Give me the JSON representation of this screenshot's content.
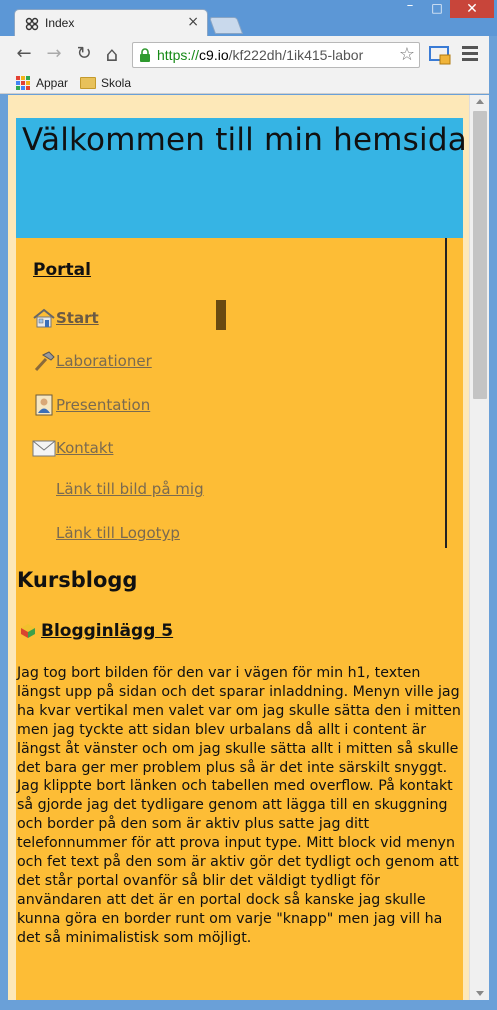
{
  "browser": {
    "tab_title": "Index",
    "tab_close": "×",
    "window_min": "–",
    "window_max": "□",
    "window_close": "✕",
    "nav": {
      "back": "←",
      "forward": "→",
      "reload": "↻",
      "home": "⌂"
    },
    "url": {
      "scheme": "https://",
      "host": "c9.io",
      "path": "/kf222dh/1ik415-labor"
    },
    "star": "☆",
    "bookmarks": [
      {
        "label": "Appar",
        "icon": "apps-grid-icon"
      },
      {
        "label": "Skola",
        "icon": "folder-icon"
      }
    ]
  },
  "page": {
    "header_title": "Välkommen till min hemsida",
    "nav_heading": "Portal",
    "nav_items": [
      {
        "label": "Start",
        "icon": "house-icon",
        "active": true
      },
      {
        "label": "Laborationer",
        "icon": "hammer-icon"
      },
      {
        "label": "Presentation",
        "icon": "portrait-icon"
      },
      {
        "label": "Kontakt",
        "icon": "envelope-icon"
      }
    ],
    "sub_links": [
      "Länk till bild på mig",
      "Länk till Logotyp"
    ],
    "blog_title": "Kursblogg",
    "post_title": "Blogginlägg 5",
    "post_body": "Jag tog bort bilden för den var i vägen för min h1, texten längst upp på sidan och det sparar inladdning. Menyn ville jag ha kvar vertikal men valet var om jag skulle sätta den i mitten men jag tyckte att sidan blev urbalans då allt i content är längst åt vänster och om jag skulle sätta allt i mitten så skulle det bara ger mer problem plus så är det inte särskilt snyggt. Jag klippte bort länken och tabellen med overflow. På kontakt så gjorde jag det tydligare genom att lägga till en skuggning och border på den som är aktiv plus satte jag ditt telefonnummer för att prova input type. Mitt block vid menyn och fet text på den som är aktiv gör det tydligt och genom att det står portal ovanför så blir det väldigt tydligt för användaren att det är en portal dock så kanske jag skulle kunna göra en border runt om varje \"knapp\" men jag vill ha det så minimalistisk som möjligt."
  },
  "colors": {
    "page_bg": "#fde8b8",
    "content_bg": "#fdbd36",
    "header_bg": "#36b4e4",
    "active_marker": "#6a4a10"
  }
}
